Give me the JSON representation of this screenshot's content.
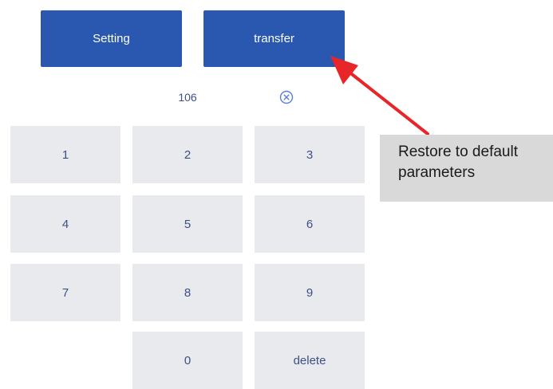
{
  "top_buttons": {
    "setting_label": "Setting",
    "transfer_label": "transfer"
  },
  "display": {
    "value": "106",
    "clear_icon": "clear-circle-icon"
  },
  "keypad": {
    "keys": [
      "1",
      "2",
      "3",
      "4",
      "5",
      "6",
      "7",
      "8",
      "9",
      "0",
      "delete"
    ]
  },
  "annotation": {
    "text_line1": "Restore to default",
    "text_line2": "parameters"
  },
  "colors": {
    "button_blue": "#2a58b0",
    "key_bg": "#e9eaee",
    "key_text": "#3d4f86",
    "arrow_red": "#e8262a",
    "callout_bg": "#d9d9d9"
  }
}
